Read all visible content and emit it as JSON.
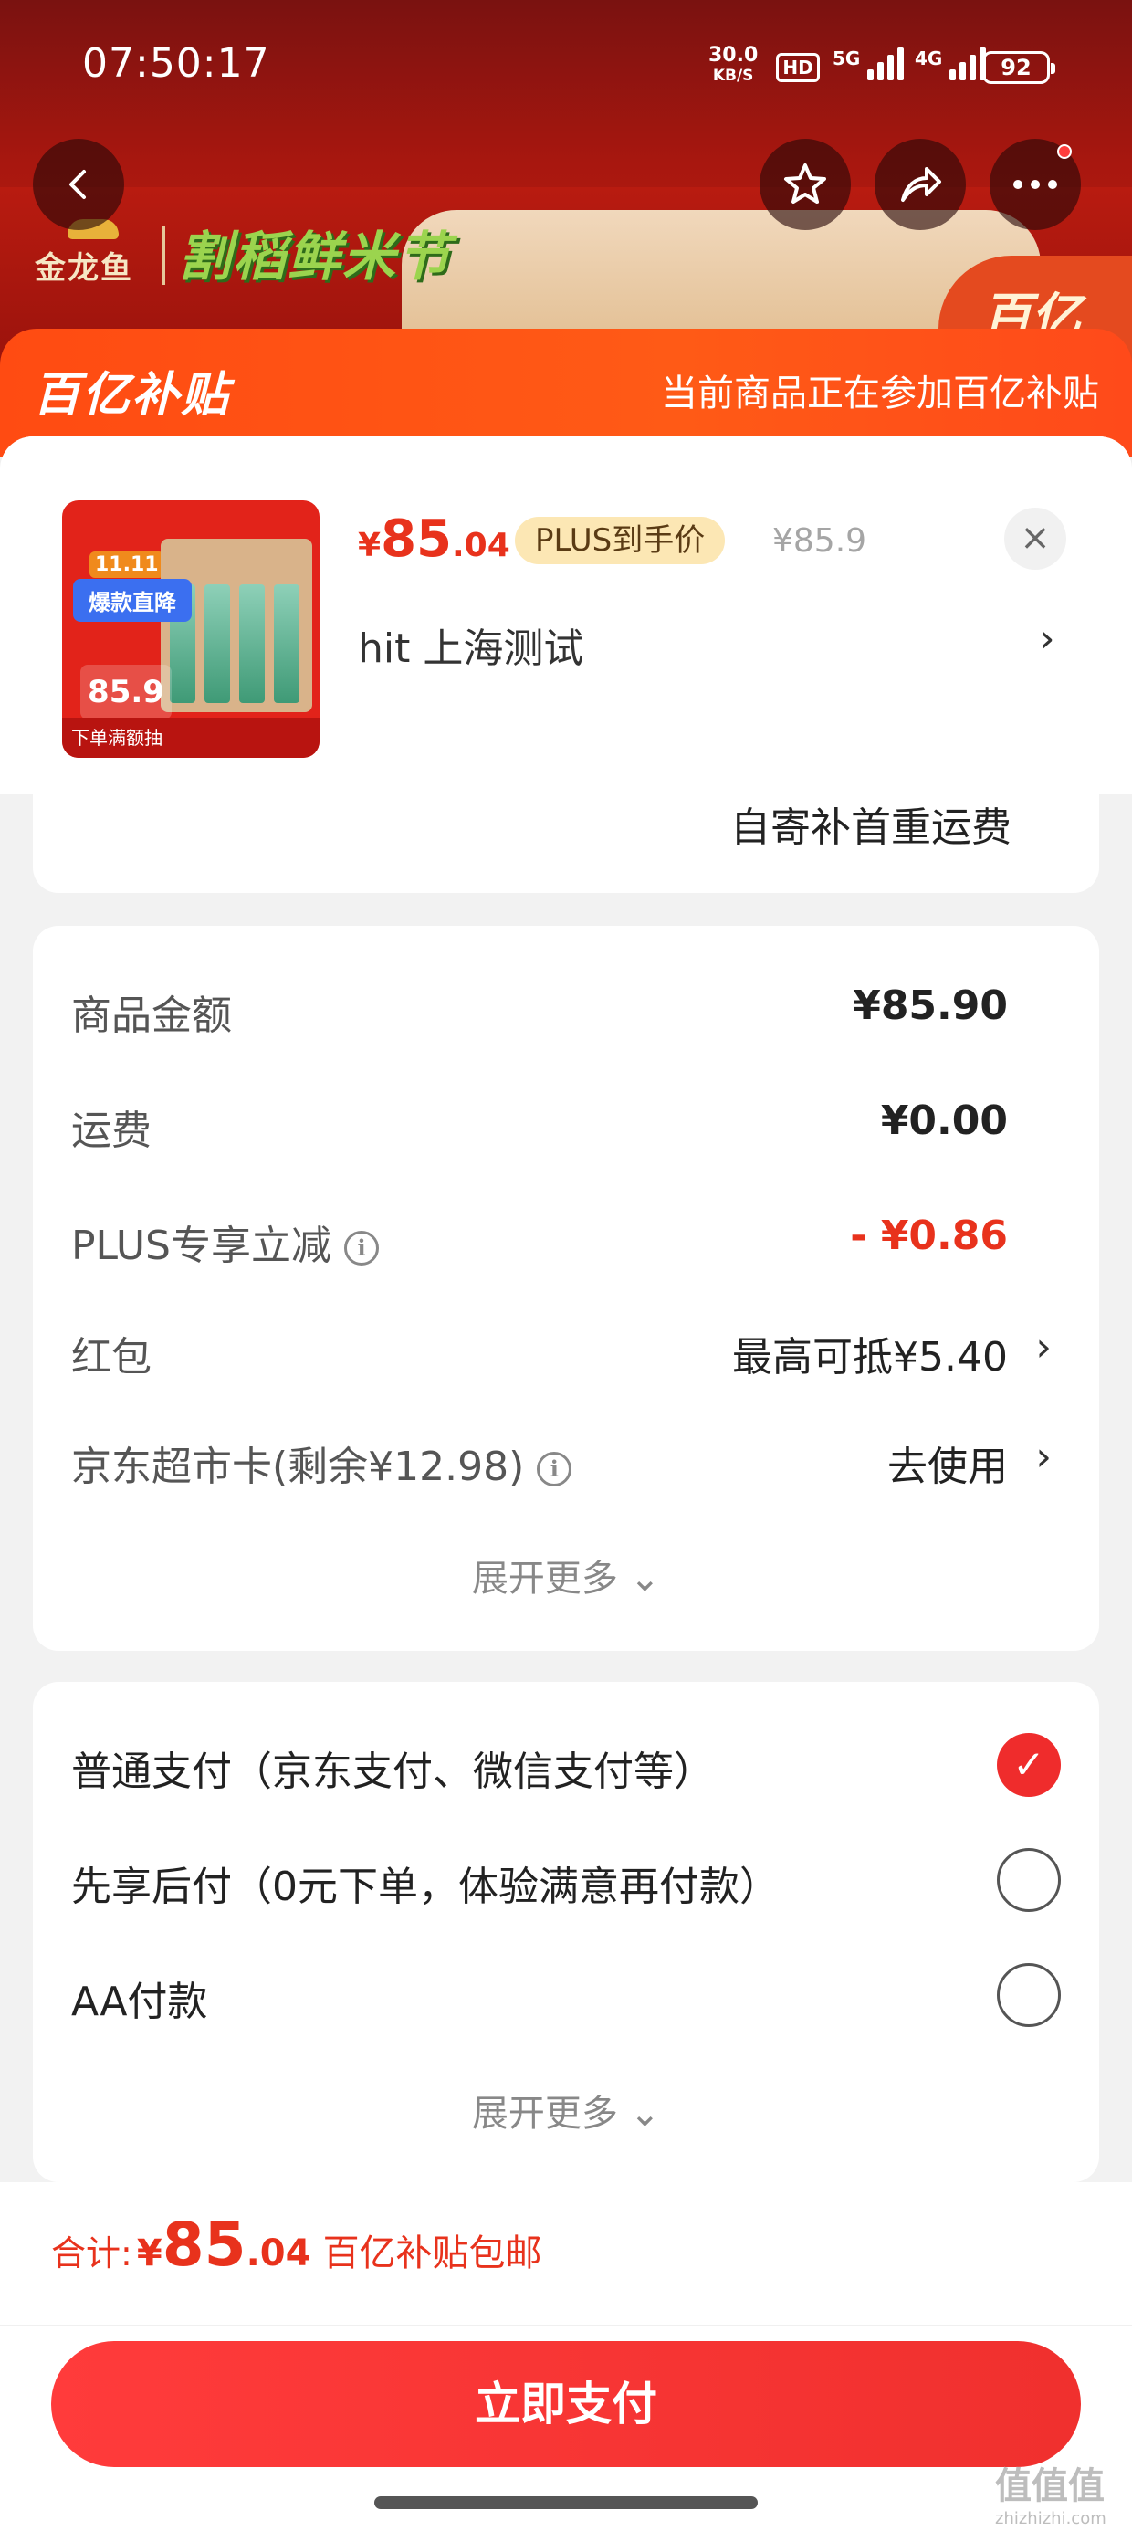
{
  "status_bar": {
    "time": "07:50:17",
    "net_speed": "30.0",
    "net_unit": "KB/S",
    "hd": "HD",
    "sig1": "5G",
    "sig2": "4G",
    "battery": "92"
  },
  "banner": {
    "brand": "金龙鱼",
    "festival": "割稻鲜米节",
    "corner": "百亿"
  },
  "strip": {
    "logo": "百亿补贴",
    "note": "当前商品正在参加百亿补贴"
  },
  "product": {
    "thumb_tag": "11.11",
    "thumb_badge": "爆款直降",
    "thumb_price": "85.9",
    "thumb_bottom": "下单满额抽",
    "price_symbol": "¥",
    "price_int": "85",
    "price_dec": ".04",
    "plus_label": "PLUS到手价",
    "original_price": "¥85.9",
    "name": "hit  上海测试"
  },
  "shipping_note": "自寄补首重运费",
  "amounts": {
    "rows": [
      {
        "label": "商品金额",
        "value": "¥85.90"
      },
      {
        "label": "运费",
        "value": "¥0.00"
      },
      {
        "label": "PLUS专享立减",
        "value": "- ¥0.86"
      },
      {
        "label": "红包",
        "value": "最高可抵¥5.40"
      },
      {
        "label": "京东超市卡(剩余¥12.98)",
        "value": "去使用"
      }
    ],
    "more": "展开更多"
  },
  "payment": {
    "options": [
      {
        "label": "普通支付（京东支付、微信支付等）",
        "selected": true
      },
      {
        "label": "先享后付（0元下单，体验满意再付款）",
        "selected": false
      },
      {
        "label": "AA付款",
        "selected": false
      }
    ],
    "more": "展开更多"
  },
  "footer": {
    "total_label": "合计:",
    "symbol": "¥",
    "int": "85",
    "dec": ".04",
    "note": "百亿补贴包邮",
    "pay_button": "立即支付"
  },
  "watermark": {
    "text": "值值值",
    "site": "zhizhizhi.com"
  },
  "colors": {
    "accent_red": "#e8321c",
    "strip_orange": "#ff4b12",
    "pay_button": "#f0302e",
    "plus_tag": "#fce7b4"
  }
}
